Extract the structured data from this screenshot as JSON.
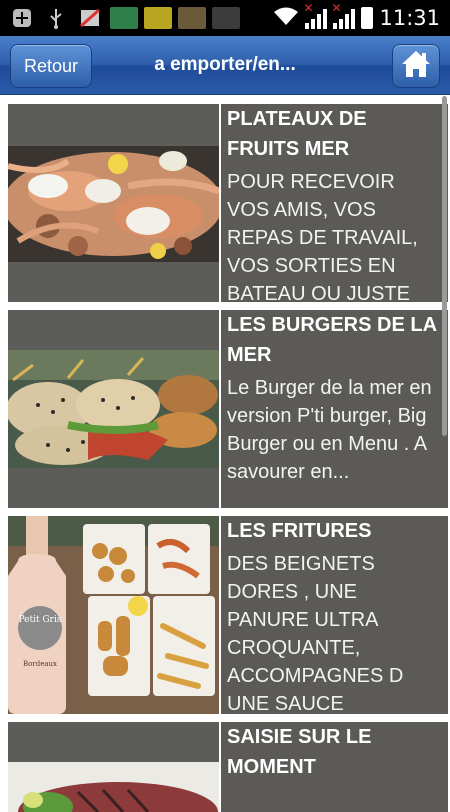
{
  "status": {
    "time": "11:31",
    "icons": [
      "plus-icon",
      "usb-icon",
      "blocked-icon",
      "app-icon-1",
      "app-icon-2",
      "app-icon-3",
      "app-icon-4",
      "wifi-icon",
      "signal-icon",
      "signal-icon-2",
      "battery-icon"
    ]
  },
  "header": {
    "back_label": "Retour",
    "title": "a emporter/en...",
    "home_icon": "home-icon"
  },
  "items": [
    {
      "title": "PLATEAUX DE FRUITS MER",
      "description": "POUR RECEVOIR VOS AMIS, VOS REPAS DE TRAVAIL, VOS SORTIES EN BATEAU OU JUSTE",
      "image": "seafood-platter-photo"
    },
    {
      "title": "LES BURGERS DE LA MER",
      "description": "Le Burger de la mer en version P'ti burger, Big Burger ou en Menu . A savourer en...",
      "image": "sea-burgers-photo"
    },
    {
      "title": "LES FRITURES",
      "description": "DES BEIGNETS DORES , UNE PANURE ULTRA CROQUANTE, ACCOMPAGNES D UNE SAUCE",
      "image": "fritures-and-wine-photo",
      "bottle_label": "Petit Gris",
      "bottle_sub": "Bordeaux"
    },
    {
      "title": "SAISIE SUR LE MOMENT",
      "description": "",
      "image": "seared-tuna-photo"
    }
  ],
  "colors": {
    "header": "#2f5fae",
    "tile": "#5b5a57"
  }
}
